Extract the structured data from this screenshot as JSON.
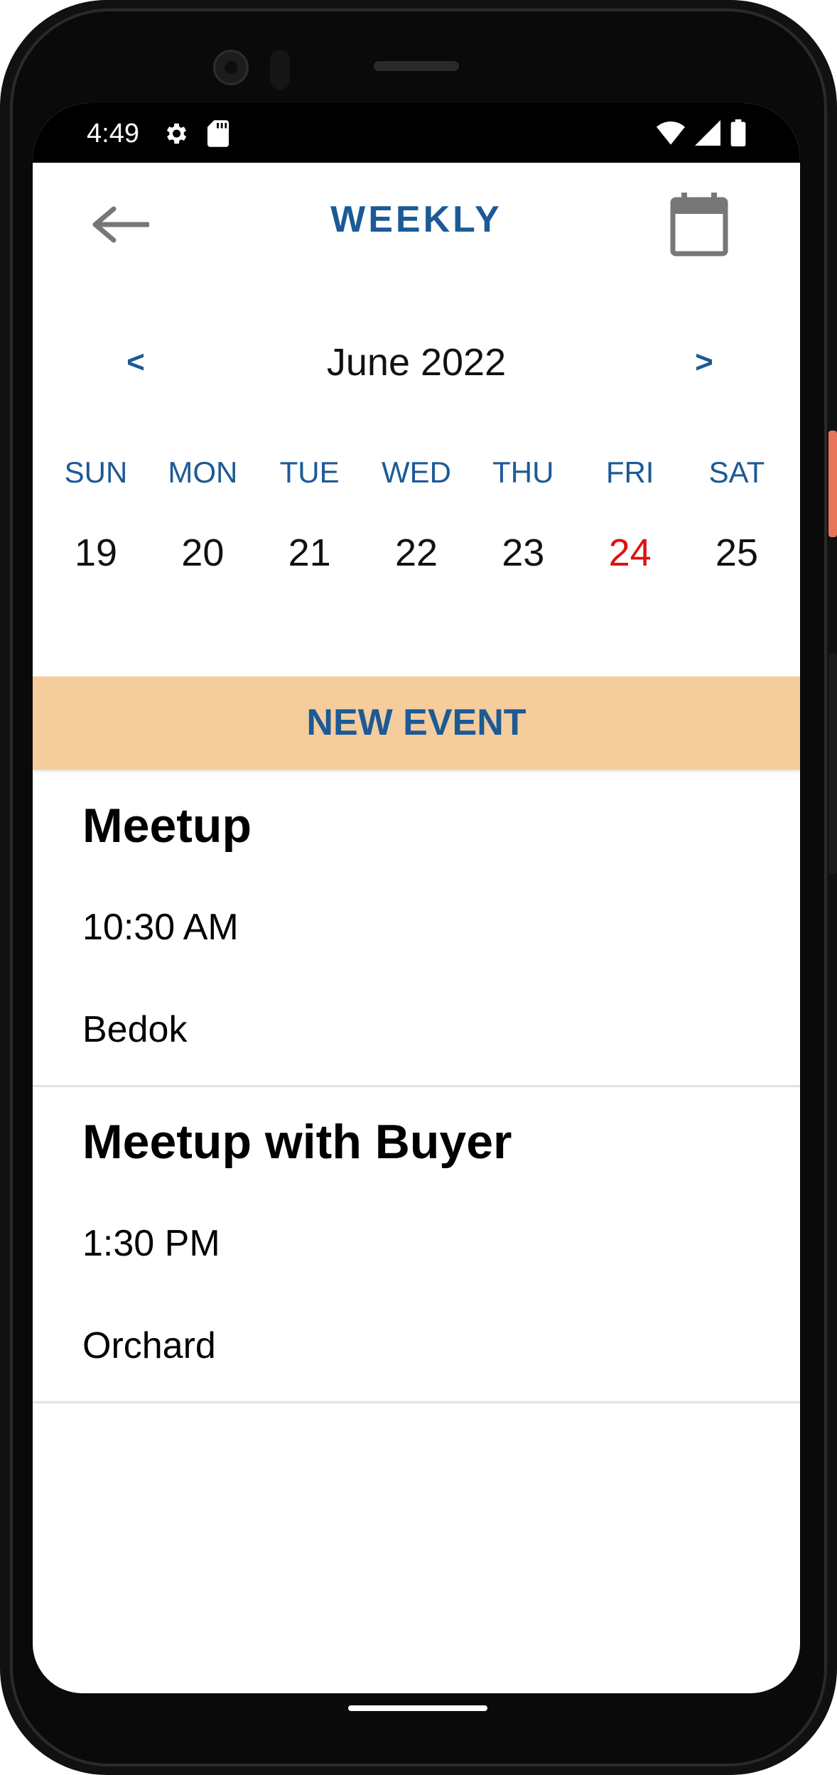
{
  "status_bar": {
    "time": "4:49",
    "icons": [
      "settings-icon",
      "sd-card-icon",
      "wifi-icon",
      "signal-icon",
      "battery-icon"
    ]
  },
  "header": {
    "title": "WEEKLY",
    "back_icon": "arrow-left-icon",
    "calendar_icon": "calendar-icon"
  },
  "month_nav": {
    "prev_label": "<",
    "month_label": "June 2022",
    "next_label": ">"
  },
  "week": {
    "days": [
      {
        "name": "SUN",
        "date": "19",
        "today": false
      },
      {
        "name": "MON",
        "date": "20",
        "today": false
      },
      {
        "name": "TUE",
        "date": "21",
        "today": false
      },
      {
        "name": "WED",
        "date": "22",
        "today": false
      },
      {
        "name": "THU",
        "date": "23",
        "today": false
      },
      {
        "name": "FRI",
        "date": "24",
        "today": true
      },
      {
        "name": "SAT",
        "date": "25",
        "today": false
      }
    ]
  },
  "new_event_label": "NEW EVENT",
  "events": [
    {
      "title": "Meetup",
      "time": "10:30 AM",
      "location": "Bedok"
    },
    {
      "title": "Meetup with Buyer",
      "time": "1:30 PM",
      "location": "Orchard"
    }
  ],
  "colors": {
    "accent": "#1c5a96",
    "today": "#e01010",
    "new_event_bg": "#f5cc9c"
  }
}
